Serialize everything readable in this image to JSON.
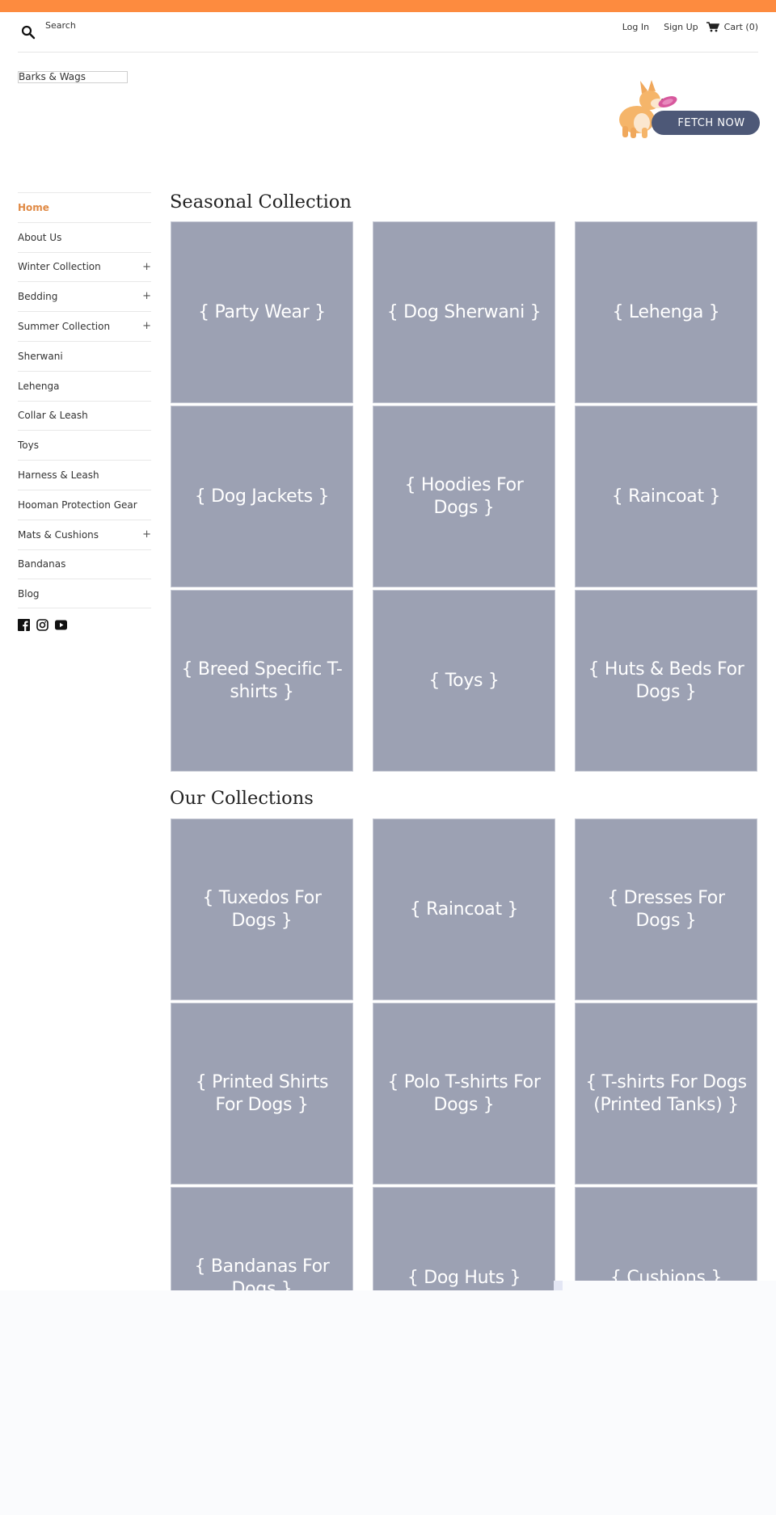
{
  "colors": {
    "announcement_bar": "#fd8b3f",
    "active_nav": "#e08a45",
    "tile_bg": "#9ca1b3",
    "promo_button": "#4d5877"
  },
  "header": {
    "search_icon": "search-icon",
    "search_label": "Search",
    "login_label": "Log In",
    "signup_label": "Sign Up",
    "cart_icon": "cart-icon",
    "cart_label": "Cart (0)"
  },
  "logo": {
    "text": "Barks & Wags"
  },
  "promo": {
    "image": "corgi-with-frisbee",
    "button_label": "FETCH NOW"
  },
  "sidebar": {
    "items": [
      {
        "label": "Home",
        "active": true,
        "expandable": false
      },
      {
        "label": "About Us",
        "active": false,
        "expandable": false
      },
      {
        "label": "Winter Collection",
        "active": false,
        "expandable": true
      },
      {
        "label": "Bedding",
        "active": false,
        "expandable": true
      },
      {
        "label": "Summer Collection",
        "active": false,
        "expandable": true
      },
      {
        "label": "Sherwani",
        "active": false,
        "expandable": false
      },
      {
        "label": "Lehenga",
        "active": false,
        "expandable": false
      },
      {
        "label": "Collar & Leash",
        "active": false,
        "expandable": false
      },
      {
        "label": "Toys",
        "active": false,
        "expandable": false
      },
      {
        "label": "Harness & Leash",
        "active": false,
        "expandable": false
      },
      {
        "label": "Hooman Protection Gear",
        "active": false,
        "expandable": false
      },
      {
        "label": "Mats & Cushions",
        "active": false,
        "expandable": true
      },
      {
        "label": "Bandanas",
        "active": false,
        "expandable": false
      },
      {
        "label": "Blog",
        "active": false,
        "expandable": false
      }
    ],
    "expand_symbol": "+",
    "social": [
      "facebook-icon",
      "instagram-icon",
      "youtube-icon"
    ]
  },
  "sections": [
    {
      "title": "Seasonal Collection",
      "tiles": [
        "{ Party Wear }",
        "{ Dog Sherwani }",
        "{ Lehenga }",
        "{ Dog Jackets }",
        "{ Hoodies For Dogs }",
        "{ Raincoat }",
        "{ Breed Specific T-shirts }",
        "{ Toys }",
        "{ Huts & Beds For Dogs }"
      ]
    },
    {
      "title": "Our Collections",
      "tiles": [
        "{ Tuxedos For Dogs }",
        "{ Raincoat }",
        "{ Dresses For Dogs }",
        "{ Printed Shirts For Dogs }",
        "{ Polo T-shirts For Dogs }",
        "{ T-shirts For Dogs (Printed Tanks) }",
        "{ Bandanas For Dogs }",
        "{ Dog Huts }",
        "{ Cushions }"
      ]
    }
  ]
}
